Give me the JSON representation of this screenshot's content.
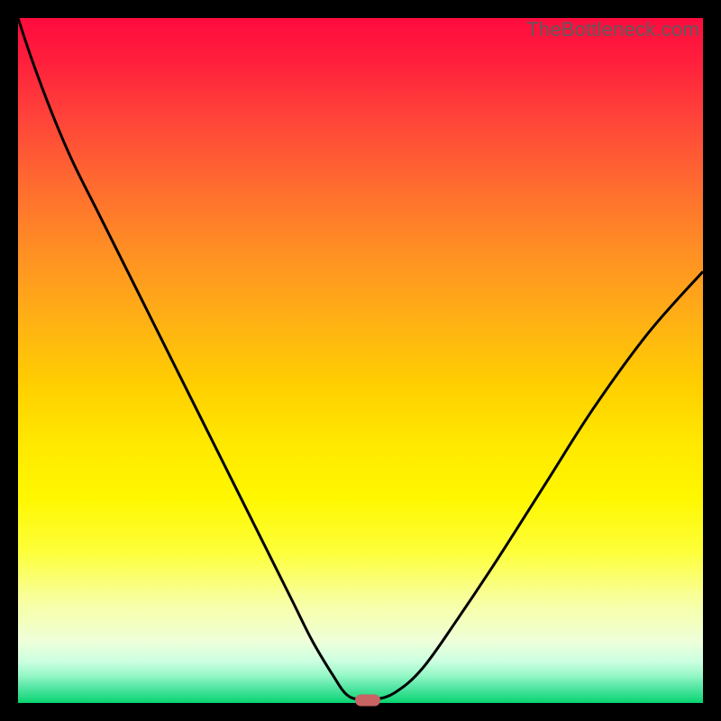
{
  "watermark": "TheBottleneck.com",
  "colors": {
    "curve_stroke": "#000000",
    "marker_fill": "#c86464"
  },
  "chart_data": {
    "type": "line",
    "title": "",
    "xlabel": "",
    "ylabel": "",
    "xlim": [
      0,
      100
    ],
    "ylim": [
      0,
      100
    ],
    "grid": false,
    "legend": false,
    "series": [
      {
        "name": "bottleneck-curve",
        "x": [
          0,
          2,
          5,
          8,
          12,
          16,
          20,
          24,
          28,
          32,
          36,
          40,
          43,
          46,
          48,
          50,
          52,
          55,
          59,
          64,
          70,
          77,
          84,
          92,
          100
        ],
        "y": [
          100,
          94,
          86,
          79,
          71,
          63,
          55,
          47,
          39,
          31,
          23,
          15,
          9,
          4,
          1.2,
          0.5,
          0.5,
          1.5,
          5,
          12,
          21,
          32,
          43,
          54,
          63
        ]
      }
    ],
    "marker": {
      "x": 51,
      "y": 0.4
    },
    "background_gradient_note": "vertical red→yellow→green heatmap"
  }
}
